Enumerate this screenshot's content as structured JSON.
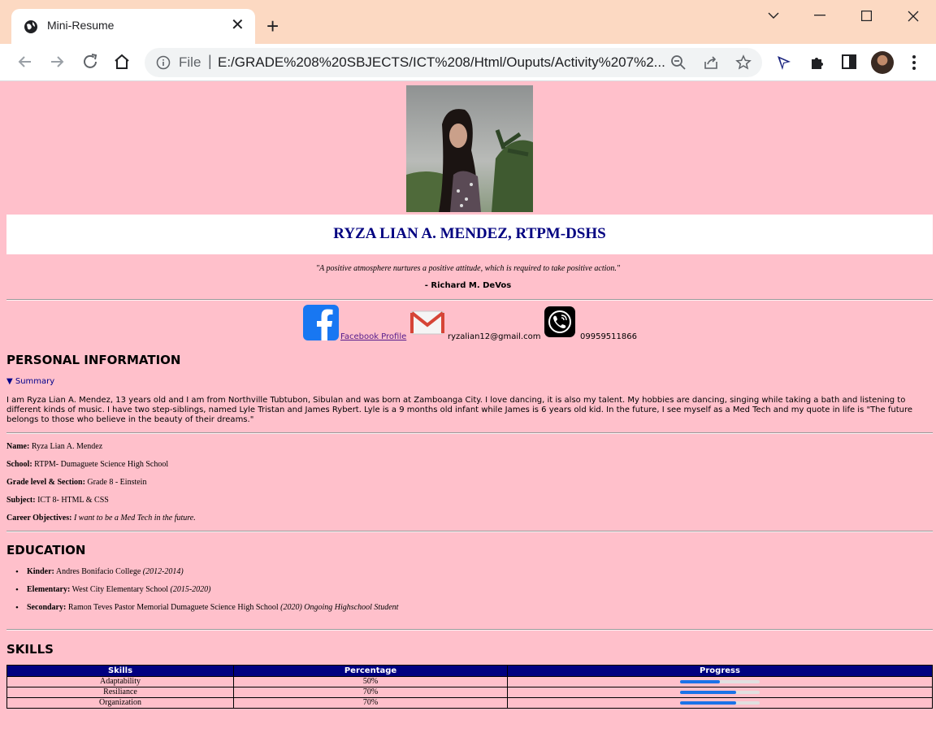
{
  "browser": {
    "tab_title": "Mini-Resume",
    "file_label": "File",
    "url": "E:/GRADE%208%20SBJECTS/ICT%208/Html/Ouputs/Activity%207%2..."
  },
  "resume": {
    "name": "RYZA LIAN A. MENDEZ, RTPM-DSHS",
    "quote": "\"A positive atmosphere nurtures a positive attitude, which is required to take positive action.\"",
    "quote_author": "- Richard M. DeVos",
    "contacts": {
      "facebook_label": "Facebook Profile",
      "email": "ryzalian12@gmail.com",
      "phone": "09959511866"
    },
    "personal": {
      "heading": "PERSONAL INFORMATION",
      "summary_label": "▼ Summary",
      "summary_text": "I am Ryza Lian A. Mendez, 13 years old and I am from Northville Tubtubon, Sibulan and was born at Zamboanga City. I love dancing, it is also my talent. My hobbies are dancing, singing while taking a bath and listening to different kinds of music. I have two step-siblings, named Lyle Tristan and James Rybert. Lyle is a 9 months old infant while James is 6 years old kid. In the future, I see myself as a Med Tech and my quote in life is \"The future belongs to those who believe in the beauty of their dreams.\"",
      "fields": [
        {
          "label": "Name:",
          "value": "Ryza Lian A. Mendez"
        },
        {
          "label": "School:",
          "value": "RTPM- Dumaguete Science High School"
        },
        {
          "label": "Grade level & Section:",
          "value": "Grade 8 - Einstein"
        },
        {
          "label": "Subject:",
          "value": "ICT 8- HTML & CSS"
        },
        {
          "label": "Career Objectives:",
          "value": "I want to be a Med Tech in the future."
        }
      ]
    },
    "education": {
      "heading": "EDUCATION",
      "items": [
        {
          "level": "Kinder:",
          "school": "Andres Bonifacio College",
          "years": "(2012-2014)"
        },
        {
          "level": "Elementary:",
          "school": "West City Elementary School",
          "years": "(2015-2020)"
        },
        {
          "level": "Secondary:",
          "school": "Ramon Teves Pastor Memorial Dumaguete Science High School",
          "years": "(2020) Ongoing Highschool Student"
        }
      ]
    },
    "skills": {
      "heading": "SKILLS",
      "columns": [
        "Skills",
        "Percentage",
        "Progress"
      ],
      "rows": [
        {
          "skill": "Adaptability",
          "percentage": "50%",
          "progress": 0.5
        },
        {
          "skill": "Resiliance",
          "percentage": "70%",
          "progress": 0.7
        },
        {
          "skill": "Organization",
          "percentage": "70%",
          "progress": 0.7
        }
      ]
    }
  }
}
